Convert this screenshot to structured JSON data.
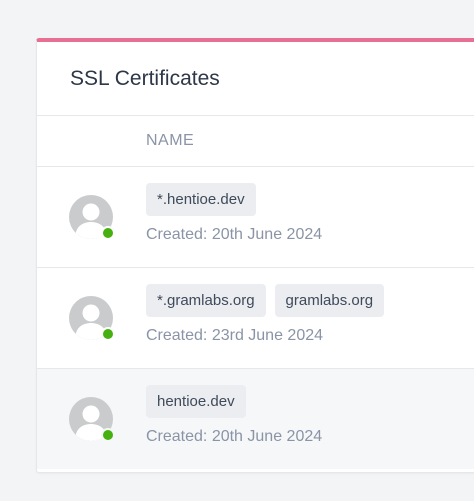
{
  "card": {
    "title": "SSL Certificates",
    "accent_color": "#e76f93"
  },
  "table": {
    "columns": [
      "NAME"
    ]
  },
  "certificates": [
    {
      "domains": [
        "*.hentioe.dev"
      ],
      "created": "Created: 20th June 2024",
      "status": "active"
    },
    {
      "domains": [
        "*.gramlabs.org",
        "gramlabs.org"
      ],
      "created": "Created: 23rd June 2024",
      "status": "active"
    },
    {
      "domains": [
        "hentioe.dev"
      ],
      "created": "Created: 20th June 2024",
      "status": "active"
    }
  ],
  "icons": {
    "avatar": "user-avatar-icon",
    "status": "status-online-icon"
  },
  "colors": {
    "status_active": "#45b010",
    "tag_background": "#ebedf0"
  }
}
